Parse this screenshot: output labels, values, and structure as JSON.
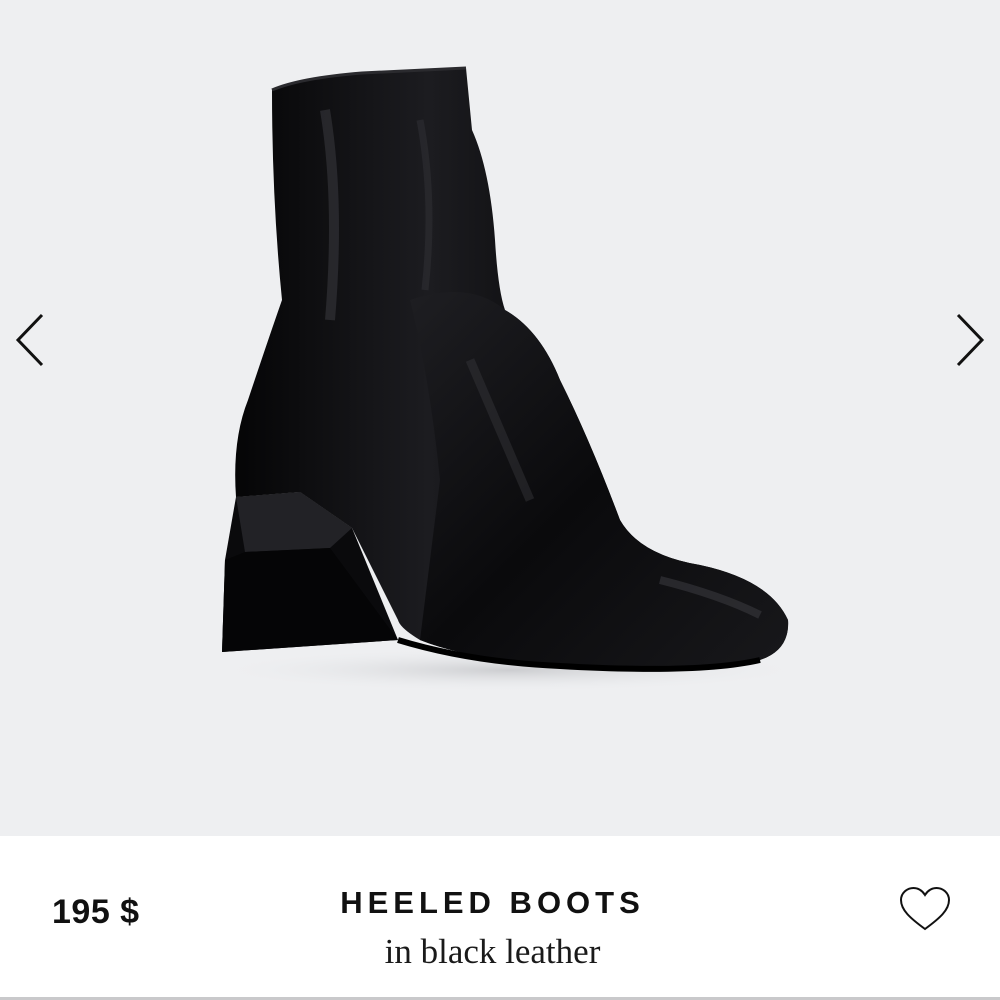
{
  "product": {
    "price": "195 $",
    "title": "HEELED BOOTS",
    "subtitle": "in black leather",
    "image_icon": "boot-photo",
    "favorite_icon": "heart-outline-icon"
  },
  "carousel": {
    "prev_icon": "chevron-left-icon",
    "next_icon": "chevron-right-icon"
  },
  "colors": {
    "image_background": "#eeeff1",
    "text": "#111111",
    "boot": "#0d0d0f"
  }
}
